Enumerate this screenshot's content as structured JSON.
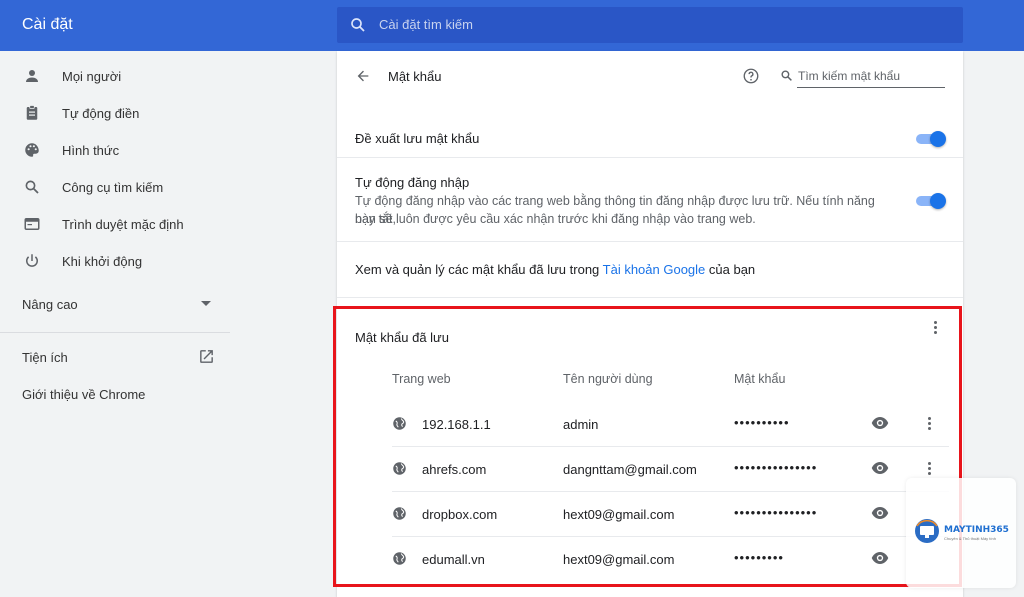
{
  "header": {
    "title": "Cài đặt",
    "search_placeholder": "Cài đặt tìm kiếm"
  },
  "sidebar": {
    "items": [
      {
        "label": "Mọi người",
        "icon": "person-icon"
      },
      {
        "label": "Tự động điền",
        "icon": "clipboard-icon"
      },
      {
        "label": "Hình thức",
        "icon": "palette-icon"
      },
      {
        "label": "Công cụ tìm kiếm",
        "icon": "search-icon"
      },
      {
        "label": "Trình duyệt mặc định",
        "icon": "browser-icon"
      },
      {
        "label": "Khi khởi động",
        "icon": "power-icon"
      }
    ],
    "advanced": "Nâng cao",
    "extensions": "Tiện ích",
    "about": "Giới thiệu về Chrome"
  },
  "passwords": {
    "title": "Mật khẩu",
    "search_placeholder": "Tìm kiếm mật khẩu",
    "offer_save": "Đề xuất lưu mật khẩu",
    "auto_signin": "Tự động đăng nhập",
    "auto_signin_desc_1": "Tự động đăng nhập vào các trang web bằng thông tin đăng nhập được lưu trữ. Nếu tính năng này tắt,",
    "auto_signin_desc_2": "bạn sẽ luôn được yêu cầu xác nhận trước khi đăng nhập vào trang web.",
    "manage_prefix": "Xem và quản lý các mật khẩu đã lưu trong ",
    "manage_link": "Tài khoản Google",
    "manage_suffix": " của bạn",
    "saved_title": "Mật khẩu đã lưu",
    "columns": {
      "site": "Trang web",
      "user": "Tên người dùng",
      "password": "Mật khẩu"
    },
    "rows": [
      {
        "site": "192.168.1.1",
        "user": "admin",
        "password": "••••••••••"
      },
      {
        "site": "ahrefs.com",
        "user": "dangnttam@gmail.com",
        "password": "•••••••••••••••"
      },
      {
        "site": "dropbox.com",
        "user": "hext09@gmail.com",
        "password": "•••••••••••••••"
      },
      {
        "site": "edumall.vn",
        "user": "hext09@gmail.com",
        "password": "•••••••••"
      }
    ],
    "toggles": {
      "offer_save": true,
      "auto_signin": true
    }
  },
  "watermark": {
    "brand": "MAYTINH365",
    "sub": "Chuyên & Thủ thuật Máy tính"
  },
  "colors": {
    "header": "#3367d6",
    "accent": "#1a73e8",
    "highlight": "#e8141b"
  }
}
